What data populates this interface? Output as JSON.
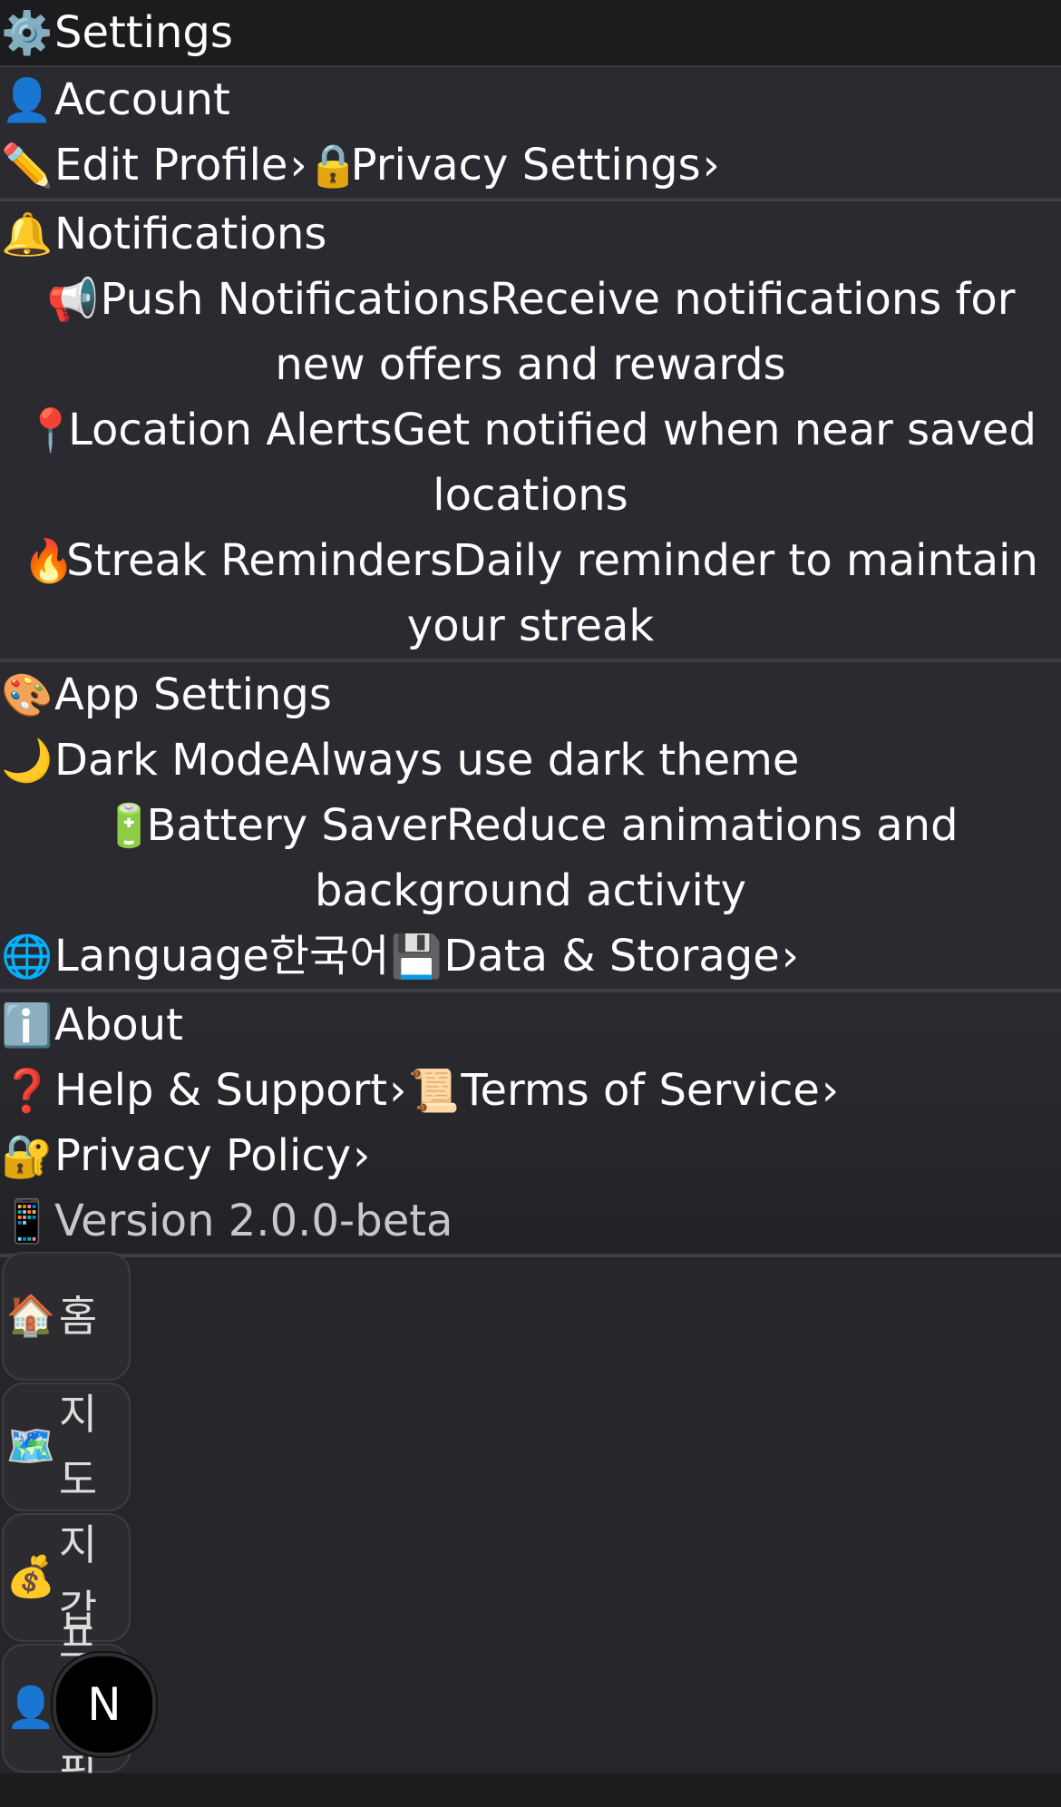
{
  "header": {
    "icon": "⚙️",
    "title": "Settings"
  },
  "account": {
    "icon": "👤",
    "title": "Account",
    "edit_profile": {
      "icon": "✏️",
      "label": "Edit Profile",
      "chevron": "›"
    },
    "privacy_settings": {
      "icon": "🔒",
      "label": "Privacy Settings",
      "chevron": "›"
    }
  },
  "notifications": {
    "icon": "🔔",
    "title": "Notifications",
    "push": {
      "icon": "📢",
      "label": "Push Notifications",
      "desc": "Receive notifications for new offers and rewards"
    },
    "location": {
      "icon": "📍",
      "label": "Location Alerts",
      "desc": "Get notified when near saved locations"
    },
    "streak": {
      "icon": "🔥",
      "label": "Streak Reminders",
      "desc": "Daily reminder to maintain your streak"
    }
  },
  "app_settings": {
    "icon": "🎨",
    "title": "App Settings",
    "dark_mode": {
      "icon": "🌙",
      "label": "Dark Mode",
      "desc": "Always use dark theme"
    },
    "battery": {
      "icon": "🔋",
      "label": "Battery Saver",
      "desc": "Reduce animations and background activity"
    },
    "language": {
      "icon": "🌐",
      "label": "Language",
      "value": "한국어"
    },
    "data_storage": {
      "icon": "💾",
      "label": "Data & Storage",
      "chevron": "›"
    }
  },
  "about": {
    "icon": "ℹ️",
    "title": "About",
    "help": {
      "icon": "❓",
      "label": "Help & Support",
      "chevron": "›"
    },
    "terms": {
      "icon": "📜",
      "label": "Terms of Service",
      "chevron": "›"
    },
    "privacy_policy": {
      "icon": "🔐",
      "label": "Privacy Policy",
      "chevron": "›"
    },
    "version": {
      "icon": "📱",
      "label": "Version 2.0.0-beta"
    }
  },
  "nav": {
    "home": {
      "icon": "🏠",
      "label": "홈"
    },
    "map": {
      "icon": "🗺️",
      "label": "지도"
    },
    "wallet": {
      "icon": "💰",
      "label": "지갑"
    },
    "profile": {
      "icon": "👤",
      "label": "프로필"
    }
  },
  "fab": {
    "label": "N"
  }
}
